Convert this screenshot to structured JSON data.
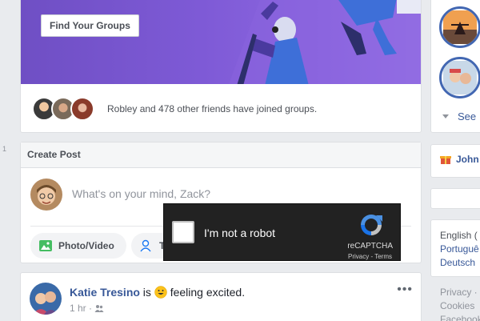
{
  "groups_card": {
    "find_button": "Find Your Groups",
    "friends_text": "Robley and 478 other friends have joined groups."
  },
  "left_marker": "1",
  "create_post": {
    "header": "Create Post",
    "placeholder": "What's on your mind, Zack?",
    "photo_video_label": "Photo/Video",
    "tag_label": "T"
  },
  "recaptcha": {
    "label": "I'm not a robot",
    "brand": "reCAPTCHA",
    "privacy": "Privacy",
    "terms": "Terms",
    "separator": " - "
  },
  "post": {
    "author": "Katie Tresino",
    "is_text": " is ",
    "feeling": "feeling excited.",
    "time": "1 hr",
    "more": "•••"
  },
  "right_column": {
    "see_more": "See",
    "birthday_name": "John",
    "languages": [
      "English (",
      "Portuguê",
      "Deutsch"
    ],
    "footer_links": [
      "Privacy ·",
      "Cookies",
      "Facebook"
    ]
  },
  "colors": {
    "banner": "#7e5ad6",
    "link": "#385898",
    "story_ring": "#4267b2",
    "recaptcha_bg": "#222222"
  }
}
